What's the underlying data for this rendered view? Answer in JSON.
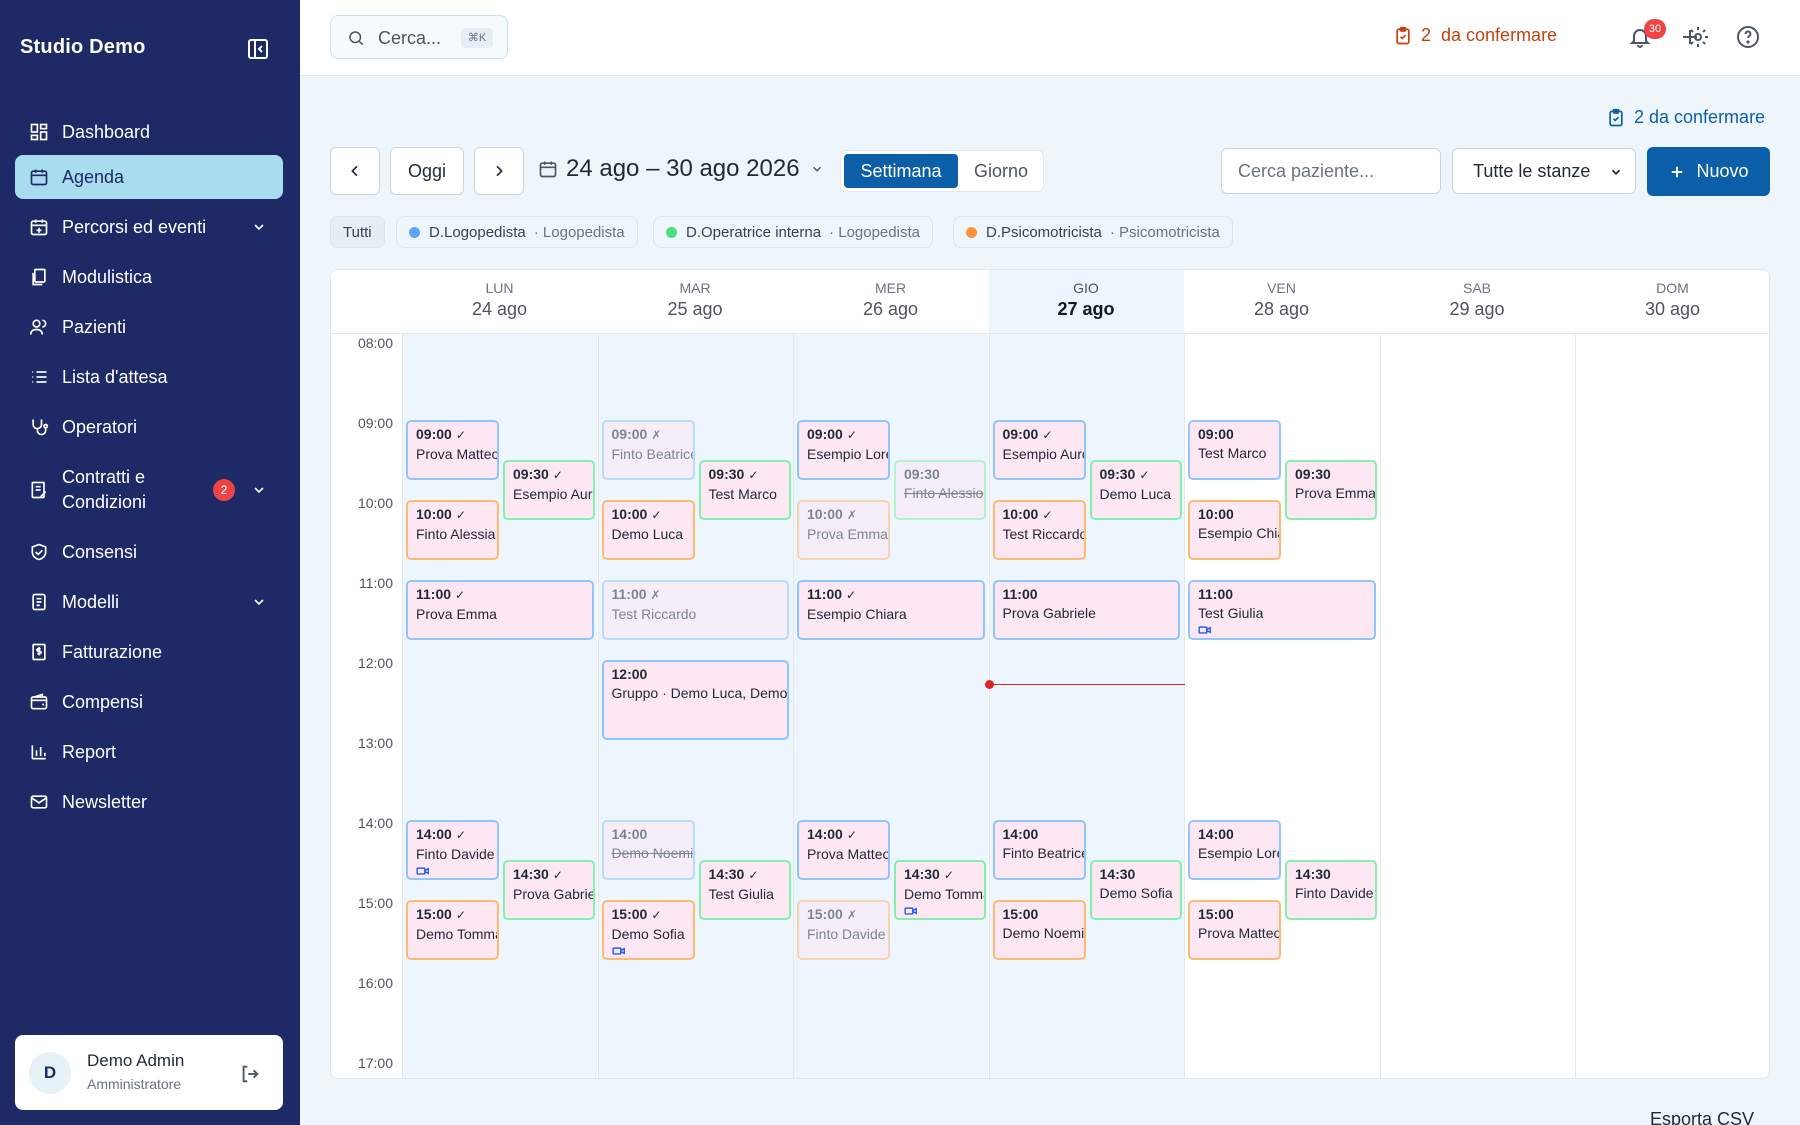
{
  "sidebar": {
    "title": "Studio Demo",
    "items": [
      {
        "label": "Dashboard",
        "icon": "dashboard-icon"
      },
      {
        "label": "Agenda",
        "icon": "calendar-icon",
        "active": true
      },
      {
        "label": "Percorsi ed eventi",
        "icon": "calendar-plus-icon",
        "chevron": true
      },
      {
        "label": "Modulistica",
        "icon": "documents-icon"
      },
      {
        "label": "Pazienti",
        "icon": "users-icon"
      },
      {
        "label": "Lista d'attesa",
        "icon": "list-icon"
      },
      {
        "label": "Operatori",
        "icon": "stethoscope-icon"
      },
      {
        "label": "Contratti e Condizioni",
        "icon": "contract-icon",
        "chevron": true,
        "badge": "2"
      },
      {
        "label": "Consensi",
        "icon": "shield-check-icon"
      },
      {
        "label": "Modelli",
        "icon": "template-icon",
        "chevron": true
      },
      {
        "label": "Fatturazione",
        "icon": "invoice-icon"
      },
      {
        "label": "Compensi",
        "icon": "wallet-icon"
      },
      {
        "label": "Report",
        "icon": "bar-chart-icon"
      },
      {
        "label": "Newsletter",
        "icon": "mail-icon"
      }
    ],
    "user": {
      "initial": "D",
      "name": "Demo Admin",
      "role": "Amministratore"
    }
  },
  "topbar": {
    "search_placeholder": "Cerca...",
    "shortcut": "⌘K",
    "pending_label": "2  da confermare",
    "notifications": "30"
  },
  "main": {
    "pending_label": "2 da confermare",
    "today_label": "Oggi",
    "range": "24 ago – 30 ago 2026",
    "view_week": "Settimana",
    "view_day": "Giorno",
    "patient_placeholder": "Cerca paziente...",
    "rooms_selected": "Tutte le stanze",
    "new_label": "Nuovo",
    "export_label": "Esporta CSV",
    "filters": {
      "all": "Tutti",
      "operators": [
        {
          "name": "D.Logopedista",
          "role": "· Logopedista",
          "color": "#60a5fa"
        },
        {
          "name": "D.Operatrice interna",
          "role": "· Logopedista",
          "color": "#4ade80"
        },
        {
          "name": "D.Psicomotricista",
          "role": "· Psicomotricista",
          "color": "#fb923c"
        }
      ]
    }
  },
  "calendar": {
    "days": [
      {
        "dow": "LUN",
        "date": "24 ago"
      },
      {
        "dow": "MAR",
        "date": "25 ago"
      },
      {
        "dow": "MER",
        "date": "26 ago"
      },
      {
        "dow": "GIO",
        "date": "27 ago",
        "today": true
      },
      {
        "dow": "VEN",
        "date": "28 ago"
      },
      {
        "dow": "SAB",
        "date": "29 ago"
      },
      {
        "dow": "DOM",
        "date": "30 ago"
      }
    ],
    "hours": [
      "08:00",
      "09:00",
      "10:00",
      "11:00",
      "12:00",
      "13:00",
      "14:00",
      "15:00",
      "16:00",
      "17:00"
    ],
    "appointments": [
      {
        "day": 0,
        "time": "09:00",
        "mark": "✓",
        "name": "Prova Matteo",
        "color": "b",
        "lane": 0
      },
      {
        "day": 0,
        "time": "09:30",
        "mark": "✓",
        "name": "Esempio Aurora",
        "color": "g",
        "lane": 1
      },
      {
        "day": 0,
        "time": "10:00",
        "mark": "✓",
        "name": "Finto Alessia",
        "color": "o",
        "lane": 0
      },
      {
        "day": 0,
        "time": "11:00",
        "mark": "✓",
        "name": "Prova Emma",
        "color": "b",
        "lane": -1
      },
      {
        "day": 0,
        "time": "14:00",
        "mark": "✓",
        "name": "Finto Davide",
        "color": "b",
        "lane": 0,
        "video": true
      },
      {
        "day": 0,
        "time": "14:30",
        "mark": "✓",
        "name": "Prova Gabriele",
        "color": "g",
        "lane": 1
      },
      {
        "day": 0,
        "time": "15:00",
        "mark": "✓",
        "name": "Demo Tommaso",
        "color": "o",
        "lane": 0
      },
      {
        "day": 1,
        "time": "09:00",
        "mark": "✗",
        "name": "Finto Beatrice",
        "color": "b",
        "lane": 0,
        "faded": true
      },
      {
        "day": 1,
        "time": "09:30",
        "mark": "✓",
        "name": "Test Marco",
        "color": "g",
        "lane": 1
      },
      {
        "day": 1,
        "time": "10:00",
        "mark": "✓",
        "name": "Demo Luca",
        "color": "o",
        "lane": 0
      },
      {
        "day": 1,
        "time": "11:00",
        "mark": "✗",
        "name": "Test Riccardo",
        "color": "b",
        "lane": -1,
        "faded": true
      },
      {
        "day": 1,
        "time": "12:00",
        "mark": "",
        "name": "Gruppo · Demo Luca, Demo Sofia",
        "color": "b",
        "lane": -1,
        "tall": true
      },
      {
        "day": 1,
        "time": "14:00",
        "mark": "",
        "name": "Demo Noemi",
        "color": "b",
        "lane": 0,
        "faded": true,
        "strike": true
      },
      {
        "day": 1,
        "time": "14:30",
        "mark": "✓",
        "name": "Test Giulia",
        "color": "g",
        "lane": 1
      },
      {
        "day": 1,
        "time": "15:00",
        "mark": "✓",
        "name": "Demo Sofia",
        "color": "o",
        "lane": 0,
        "video": true
      },
      {
        "day": 2,
        "time": "09:00",
        "mark": "✓",
        "name": "Esempio Lorenzo",
        "color": "b",
        "lane": 0
      },
      {
        "day": 2,
        "time": "09:30",
        "mark": "",
        "name": "Finto Alessio",
        "color": "g",
        "lane": 1,
        "faded": true,
        "strike": true
      },
      {
        "day": 2,
        "time": "10:00",
        "mark": "✗",
        "name": "Prova Emma",
        "color": "o",
        "lane": 0,
        "faded": true
      },
      {
        "day": 2,
        "time": "11:00",
        "mark": "✓",
        "name": "Esempio Chiara",
        "color": "b",
        "lane": -1
      },
      {
        "day": 2,
        "time": "14:00",
        "mark": "✓",
        "name": "Prova Matteo",
        "color": "b",
        "lane": 0
      },
      {
        "day": 2,
        "time": "14:30",
        "mark": "✓",
        "name": "Demo Tommaso",
        "color": "g",
        "lane": 1,
        "video": true
      },
      {
        "day": 2,
        "time": "15:00",
        "mark": "✗",
        "name": "Finto Davide",
        "color": "o",
        "lane": 0,
        "faded": true
      },
      {
        "day": 3,
        "time": "09:00",
        "mark": "✓",
        "name": "Esempio Aurora",
        "color": "b",
        "lane": 0
      },
      {
        "day": 3,
        "time": "09:30",
        "mark": "✓",
        "name": "Demo Luca",
        "color": "g",
        "lane": 1
      },
      {
        "day": 3,
        "time": "10:00",
        "mark": "✓",
        "name": "Test Riccardo",
        "color": "o",
        "lane": 0
      },
      {
        "day": 3,
        "time": "11:00",
        "mark": "",
        "name": "Prova Gabriele",
        "color": "b",
        "lane": -1
      },
      {
        "day": 3,
        "time": "14:00",
        "mark": "",
        "name": "Finto Beatrice",
        "color": "b",
        "lane": 0
      },
      {
        "day": 3,
        "time": "14:30",
        "mark": "",
        "name": "Demo Sofia",
        "color": "g",
        "lane": 1
      },
      {
        "day": 3,
        "time": "15:00",
        "mark": "",
        "name": "Demo Noemi",
        "color": "o",
        "lane": 0
      },
      {
        "day": 4,
        "time": "09:00",
        "mark": "",
        "name": "Test Marco",
        "color": "b",
        "lane": 0
      },
      {
        "day": 4,
        "time": "09:30",
        "mark": "",
        "name": "Prova Emma",
        "color": "g",
        "lane": 1
      },
      {
        "day": 4,
        "time": "10:00",
        "mark": "",
        "name": "Esempio Chiara",
        "color": "o",
        "lane": 0
      },
      {
        "day": 4,
        "time": "11:00",
        "mark": "",
        "name": "Test Giulia",
        "color": "b",
        "lane": -1,
        "video": true
      },
      {
        "day": 4,
        "time": "14:00",
        "mark": "",
        "name": "Esempio Lorenzo",
        "color": "b",
        "lane": 0
      },
      {
        "day": 4,
        "time": "14:30",
        "mark": "",
        "name": "Finto Davide",
        "color": "g",
        "lane": 1
      },
      {
        "day": 4,
        "time": "15:00",
        "mark": "",
        "name": "Prova Matteo",
        "color": "o",
        "lane": 0
      }
    ]
  }
}
